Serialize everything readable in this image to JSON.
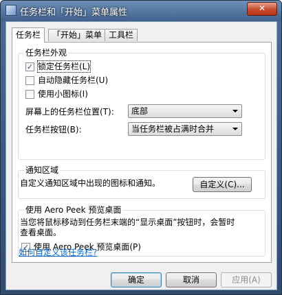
{
  "window": {
    "title": "任务栏和「开始」菜单属性",
    "close_label": "✕"
  },
  "tabs": [
    {
      "label": "任务栏"
    },
    {
      "label": "「开始」菜单"
    },
    {
      "label": "工具栏"
    }
  ],
  "appearance": {
    "title": "任务栏外观",
    "lock": {
      "label": "锁定任务栏(L)",
      "checked": true
    },
    "autohide": {
      "label": "自动隐藏任务栏(U)",
      "checked": false
    },
    "small_icons": {
      "label": "使用小图标(I)",
      "checked": false
    },
    "location_label": "屏幕上的任务栏位置(T):",
    "location_value": "底部",
    "buttons_label": "任务栏按钮(B):",
    "buttons_value": "当任务栏被占满时合并"
  },
  "notification": {
    "title": "通知区域",
    "text": "自定义通知区域中出现的图标和通知。",
    "customize_label": "自定义(C)..."
  },
  "peek": {
    "title": "使用 Aero Peek 预览桌面",
    "text_line1": "当您将鼠标移动到任务栏末端的“显示桌面”按钮时，会暂时",
    "text_line2": "查看桌面。",
    "checkbox": {
      "label": "使用 Aero Peek 预览桌面(P)",
      "checked": true
    }
  },
  "help_link": "如何自定义该任务栏?",
  "buttons": {
    "ok": "确定",
    "cancel": "取消",
    "apply": "应用(A)"
  }
}
